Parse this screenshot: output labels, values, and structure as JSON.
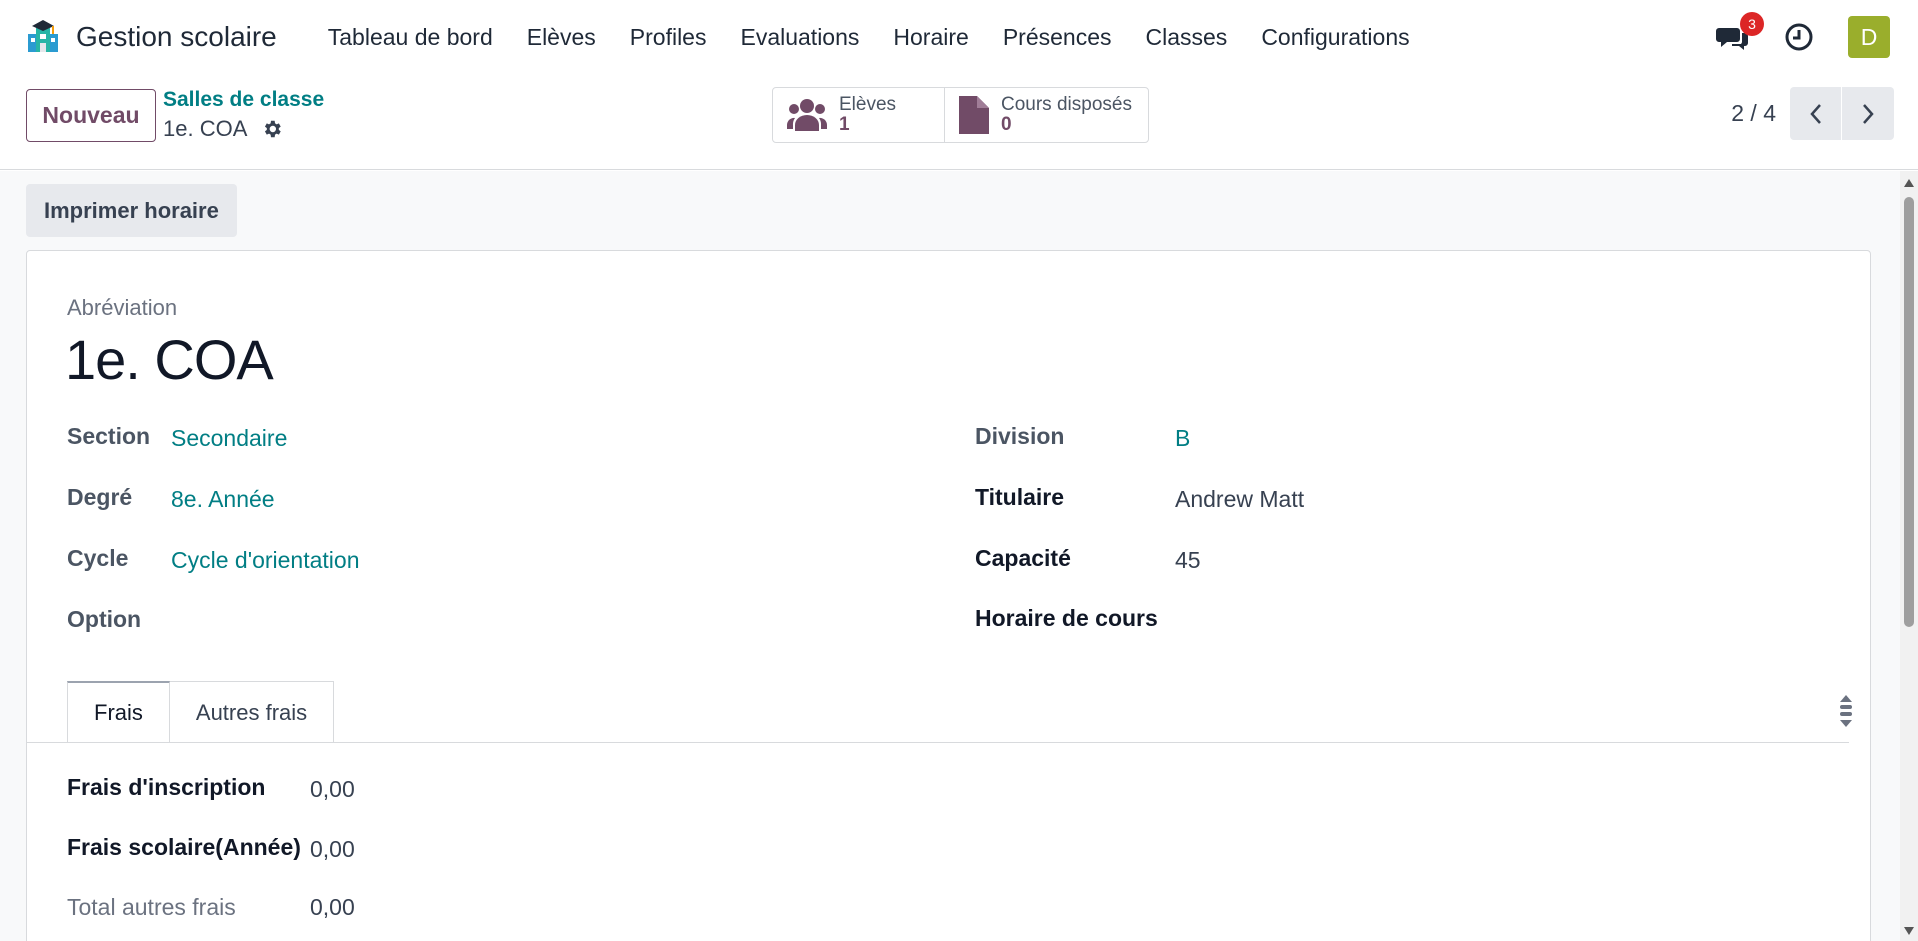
{
  "app": {
    "name": "Gestion scolaire"
  },
  "menu": [
    "Tableau de bord",
    "Elèves",
    "Profiles",
    "Evaluations",
    "Horaire",
    "Présences",
    "Classes",
    "Configurations"
  ],
  "nav_right": {
    "messages_count": "3",
    "avatar_initial": "D",
    "avatar_color": "#9aae2c"
  },
  "control": {
    "new_label": "Nouveau",
    "breadcrumb_parent": "Salles de classe",
    "breadcrumb_current": "1e. COA",
    "smart_buttons": [
      {
        "label": "Elèves",
        "value": "1",
        "icon": "users-icon"
      },
      {
        "label": "Cours disposés",
        "value": "0",
        "icon": "document-icon"
      }
    ],
    "pager": "2 / 4"
  },
  "actions": {
    "print_label": "Imprimer horaire"
  },
  "form": {
    "abbr_label": "Abréviation",
    "title": "1e. COA",
    "left": [
      {
        "label": "Section",
        "value": "Secondaire"
      },
      {
        "label": "Degré",
        "value": "8e. Année"
      },
      {
        "label": "Cycle",
        "value": "Cycle d'orientation"
      },
      {
        "label": "Option",
        "value": ""
      }
    ],
    "right": [
      {
        "label": "Division",
        "value": "B"
      },
      {
        "label": "Titulaire",
        "value": "Andrew Matt"
      },
      {
        "label": "Capacité",
        "value": "45"
      },
      {
        "label": "Horaire de cours",
        "value": ""
      }
    ],
    "tabs": [
      "Frais",
      "Autres frais"
    ],
    "fees": [
      {
        "label": "Frais d'inscription",
        "value": "0,00"
      },
      {
        "label": "Frais scolaire(Année)",
        "value": "0,00"
      },
      {
        "label": "Total autres frais",
        "value": "0,00"
      }
    ]
  },
  "colors": {
    "brand": "#714b67",
    "link": "#017e84"
  }
}
